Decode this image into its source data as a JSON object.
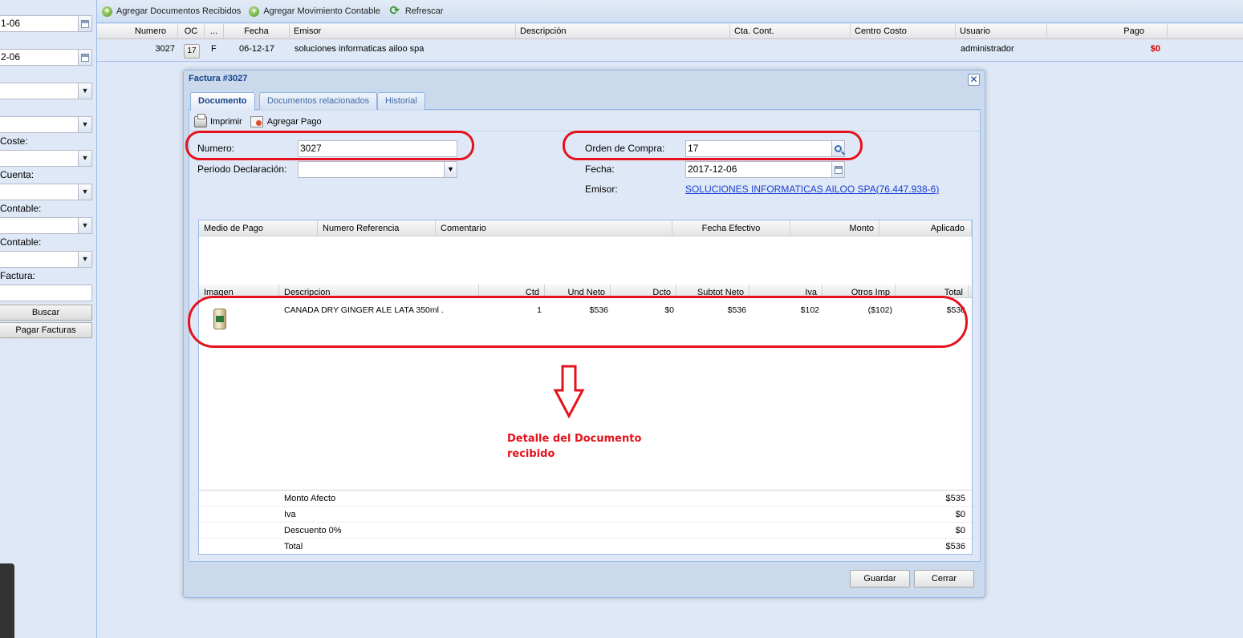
{
  "left_panel": {
    "date_from": "1-06",
    "date_to": "2-06",
    "labels": [
      "Coste:",
      "Cuenta:",
      "Contable:",
      "Contable:",
      "Factura:"
    ],
    "buscar_button": "Buscar",
    "pagar_button": "Pagar Facturas"
  },
  "toolbar": {
    "add_received": "Agregar Documentos Recibidos",
    "add_movement": "Agregar Movimiento Contable",
    "refresh": "Refrescar"
  },
  "grid": {
    "columns": [
      "Numero",
      "OC",
      "...",
      "Fecha",
      "Emisor",
      "Descripción",
      "Cta. Cont.",
      "Centro Costo",
      "Usuario",
      "Pago"
    ],
    "row": {
      "numero": "3027",
      "oc": "17",
      "tipo": "F",
      "fecha": "06-12-17",
      "emisor": "soluciones informaticas ailoo spa",
      "usuario": "administrador",
      "pago": "$0"
    }
  },
  "modal": {
    "title": "Factura #3027",
    "tabs": [
      "Documento",
      "Documentos relacionados",
      "Historial"
    ],
    "print": "Imprimir",
    "add_payment": "Agregar Pago",
    "numero_label": "Numero:",
    "numero_value": "3027",
    "periodo_label": "Periodo Declaración:",
    "periodo_value": "",
    "orden_label": "Orden de Compra:",
    "orden_value": "17",
    "fecha_label": "Fecha:",
    "fecha_value": "2017-12-06",
    "emisor_label": "Emisor:",
    "emisor_value": "SOLUCIONES INFORMATICAS AILOO SPA(76.447.938-6)",
    "payments_columns": [
      "Medio de Pago",
      "Numero Referencia",
      "Comentario",
      "Fecha Efectivo",
      "Monto",
      "Aplicado"
    ],
    "items_columns": [
      "Imagen",
      "Descripcion",
      "Ctd",
      "Und Neto",
      "Dcto",
      "Subtot Neto",
      "Iva",
      "Otros Imp",
      "Total"
    ],
    "item": {
      "descripcion": "CANADA DRY GINGER ALE LATA 350ml .",
      "ctd": "1",
      "und_neto": "$536",
      "dcto": "$0",
      "subtot": "$536",
      "iva": "$102",
      "otros": "($102)",
      "total": "$536"
    },
    "totals": [
      {
        "label": "Monto Afecto",
        "value": "$535"
      },
      {
        "label": "Iva",
        "value": "$0"
      },
      {
        "label": "Descuento 0%",
        "value": "$0"
      },
      {
        "label": "Total",
        "value": "$536"
      }
    ],
    "save": "Guardar",
    "close": "Cerrar"
  },
  "annotation": {
    "line1": "Detalle del Documento",
    "line2": "recibido",
    "color": "#e5121b"
  }
}
